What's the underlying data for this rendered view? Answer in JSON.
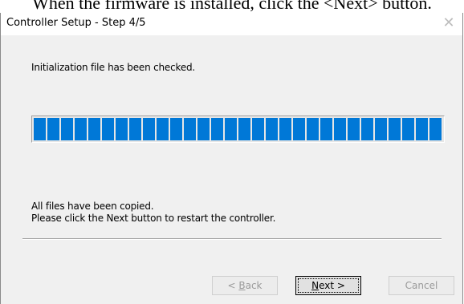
{
  "doc_text": "When the firmware is installed, click the <Next> button.",
  "window": {
    "title": "Controller Setup - Step 4/5",
    "close_glyph": "✕"
  },
  "messages": {
    "status": "Initialization file has been checked.",
    "line1": "All files have been copied.",
    "line2": "Please click the Next button to restart the controller."
  },
  "progress": {
    "value": 1.0,
    "color": "#0078d7"
  },
  "buttons": {
    "back": {
      "prefix": "< ",
      "mnemonic": "B",
      "rest": "ack",
      "enabled": false
    },
    "next": {
      "mnemonic": "N",
      "rest": "ext >",
      "enabled": true
    },
    "cancel": {
      "label": "Cancel",
      "enabled": false
    }
  }
}
